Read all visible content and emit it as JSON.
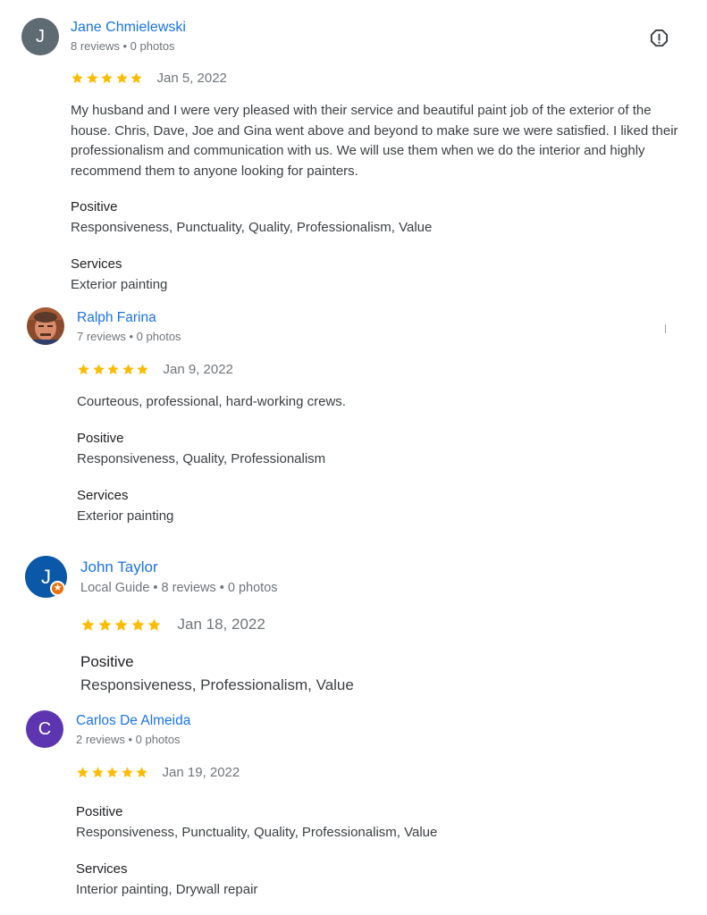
{
  "colors": {
    "name_link": "#1a73e8",
    "star": "#fbbc04",
    "avatar_jane": "#5f6b73",
    "avatar_john": "#0b57a8",
    "avatar_carlos": "#5e35b1",
    "local_guide_badge": "#e8710a"
  },
  "reviews": [
    {
      "avatar_letter": "J",
      "name": "Jane Chmielewski",
      "meta": "8 reviews • 0 photos",
      "rating": 5,
      "date": "Jan 5, 2022",
      "text": "My husband and I were very pleased with their service and beautiful paint job of the exterior of the house. Chris, Dave, Joe and Gina went above and beyond to make sure we were satisfied. I liked their professionalism and communication with us. We will use them when we do the interior and highly recommend them to anyone looking for painters.",
      "positive_label": "Positive",
      "positive": "Responsiveness, Punctuality, Quality, Professionalism, Value",
      "services_label": "Services",
      "services": "Exterior painting",
      "report_icon": "report-flag-icon"
    },
    {
      "avatar_icon": "profile-photo",
      "name": "Ralph Farina",
      "meta": "7 reviews • 0 photos",
      "rating": 5,
      "date": "Jan 9, 2022",
      "text": "Courteous, professional, hard-working crews.",
      "positive_label": "Positive",
      "positive": "Responsiveness, Quality, Professionalism",
      "services_label": "Services",
      "services": "Exterior painting"
    },
    {
      "avatar_letter": "J",
      "name": "John Taylor",
      "meta": "Local Guide • 8 reviews • 0 photos",
      "rating": 5,
      "date": "Jan 18, 2022",
      "positive_label": "Positive",
      "positive": "Responsiveness, Professionalism, Value",
      "badge_icon": "local-guide-star-icon"
    },
    {
      "avatar_letter": "C",
      "name": "Carlos De Almeida",
      "meta": "2 reviews • 0 photos",
      "rating": 5,
      "date": "Jan 19, 2022",
      "positive_label": "Positive",
      "positive": "Responsiveness, Punctuality, Quality, Professionalism, Value",
      "services_label": "Services",
      "services": "Interior painting, Drywall repair"
    }
  ]
}
